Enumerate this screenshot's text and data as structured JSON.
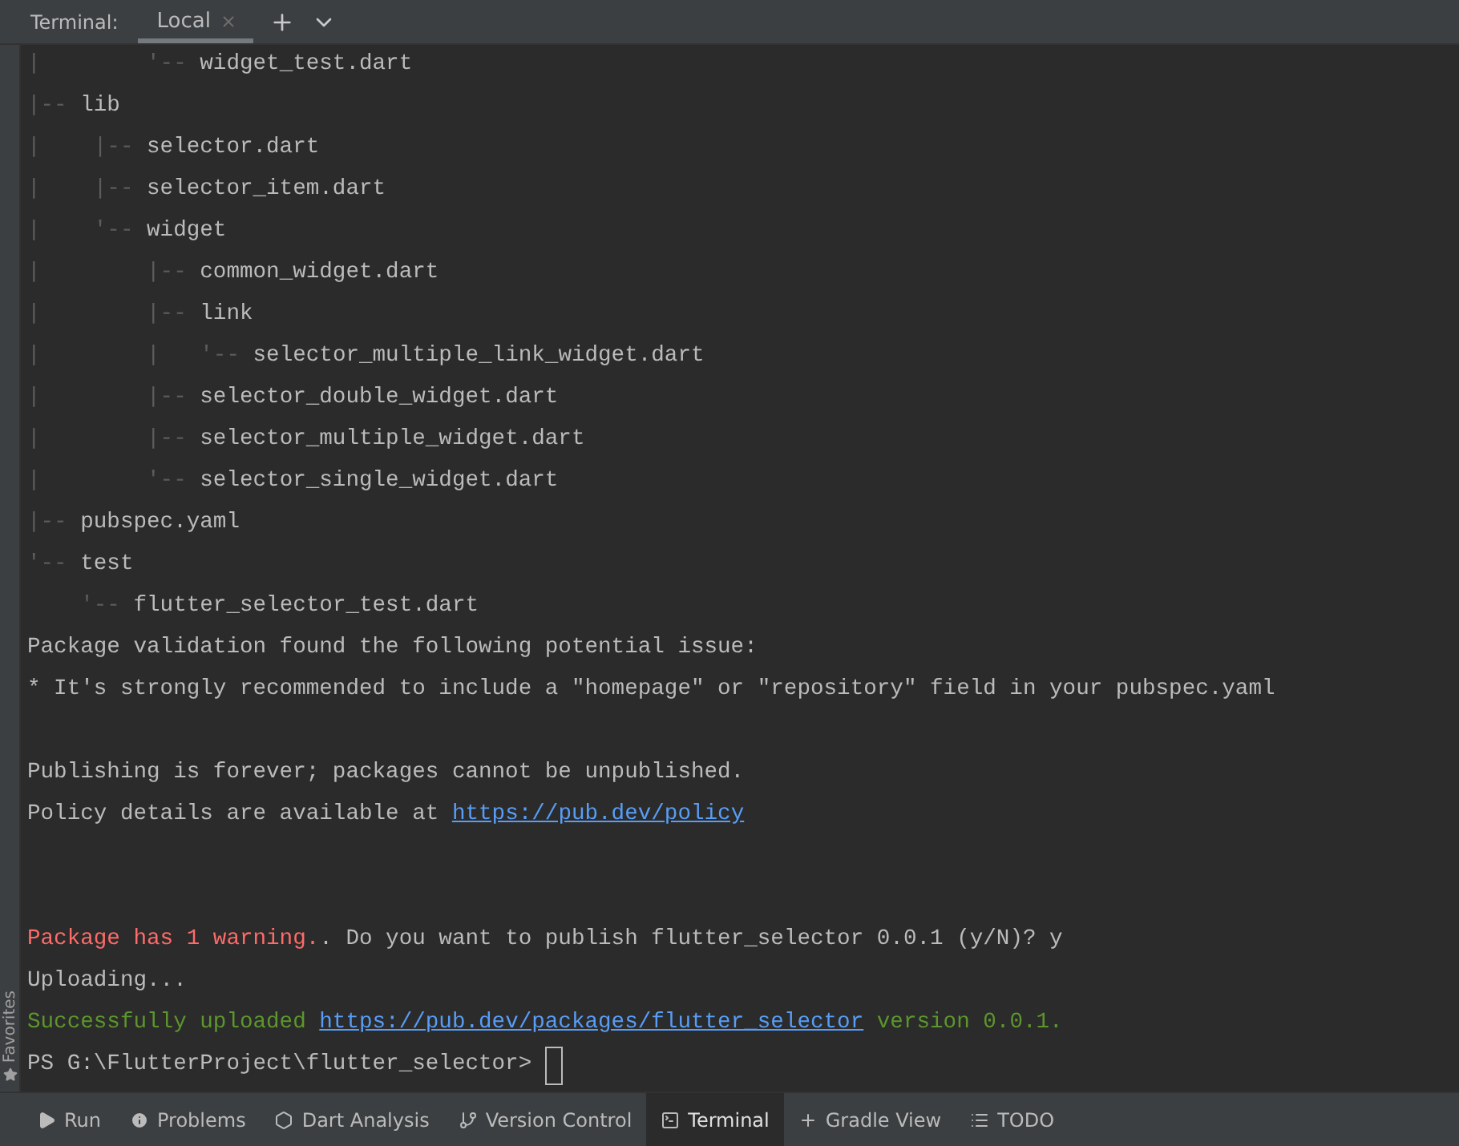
{
  "header": {
    "label": "Terminal:",
    "tabs": [
      {
        "label": "Local",
        "selected": true
      }
    ]
  },
  "side_strip": {
    "label": "Favorites"
  },
  "lines": [
    {
      "segments": [
        {
          "kind": "guide",
          "text": "|        '-- "
        },
        {
          "kind": "plain",
          "text": "widget_test.dart"
        }
      ]
    },
    {
      "segments": [
        {
          "kind": "guide",
          "text": "|-- "
        },
        {
          "kind": "plain",
          "text": "lib"
        }
      ]
    },
    {
      "segments": [
        {
          "kind": "guide",
          "text": "|    |-- "
        },
        {
          "kind": "plain",
          "text": "selector.dart"
        }
      ]
    },
    {
      "segments": [
        {
          "kind": "guide",
          "text": "|    |-- "
        },
        {
          "kind": "plain",
          "text": "selector_item.dart"
        }
      ]
    },
    {
      "segments": [
        {
          "kind": "guide",
          "text": "|    '-- "
        },
        {
          "kind": "plain",
          "text": "widget"
        }
      ]
    },
    {
      "segments": [
        {
          "kind": "guide",
          "text": "|        |-- "
        },
        {
          "kind": "plain",
          "text": "common_widget.dart"
        }
      ]
    },
    {
      "segments": [
        {
          "kind": "guide",
          "text": "|        |-- "
        },
        {
          "kind": "plain",
          "text": "link"
        }
      ]
    },
    {
      "segments": [
        {
          "kind": "guide",
          "text": "|        |   '-- "
        },
        {
          "kind": "plain",
          "text": "selector_multiple_link_widget.dart"
        }
      ]
    },
    {
      "segments": [
        {
          "kind": "guide",
          "text": "|        |-- "
        },
        {
          "kind": "plain",
          "text": "selector_double_widget.dart"
        }
      ]
    },
    {
      "segments": [
        {
          "kind": "guide",
          "text": "|        |-- "
        },
        {
          "kind": "plain",
          "text": "selector_multiple_widget.dart"
        }
      ]
    },
    {
      "segments": [
        {
          "kind": "guide",
          "text": "|        '-- "
        },
        {
          "kind": "plain",
          "text": "selector_single_widget.dart"
        }
      ]
    },
    {
      "segments": [
        {
          "kind": "guide",
          "text": "|-- "
        },
        {
          "kind": "plain",
          "text": "pubspec.yaml"
        }
      ]
    },
    {
      "segments": [
        {
          "kind": "guide",
          "text": "'-- "
        },
        {
          "kind": "plain",
          "text": "test"
        }
      ]
    },
    {
      "segments": [
        {
          "kind": "guide",
          "text": "    '-- "
        },
        {
          "kind": "plain",
          "text": "flutter_selector_test.dart"
        }
      ]
    },
    {
      "segments": [
        {
          "kind": "plain",
          "text": "Package validation found the following potential issue:"
        }
      ]
    },
    {
      "segments": [
        {
          "kind": "plain",
          "text": "* It's strongly recommended to include a \"homepage\" or \"repository\" field in your pubspec.yaml"
        }
      ]
    },
    {
      "kind": "blank"
    },
    {
      "segments": [
        {
          "kind": "plain",
          "text": "Publishing is forever; packages cannot be unpublished."
        }
      ]
    },
    {
      "segments": [
        {
          "kind": "plain",
          "text": "Policy details are available at "
        },
        {
          "kind": "link",
          "text": "https://pub.dev/policy"
        }
      ]
    },
    {
      "kind": "blank"
    },
    {
      "kind": "blank"
    },
    {
      "segments": [
        {
          "kind": "error",
          "text": "Package has 1 warning."
        },
        {
          "kind": "plain",
          "text": ". Do you want to publish flutter_selector 0.0.1 (y/N)? y"
        }
      ]
    },
    {
      "segments": [
        {
          "kind": "plain",
          "text": "Uploading..."
        }
      ]
    },
    {
      "segments": [
        {
          "kind": "success",
          "text": "Successfully uploaded "
        },
        {
          "kind": "link",
          "text": "https://pub.dev/packages/flutter_selector"
        },
        {
          "kind": "success",
          "text": " version 0.0.1."
        }
      ]
    },
    {
      "segments": [
        {
          "kind": "plain",
          "text": "PS G:\\FlutterProject\\flutter_selector> "
        },
        {
          "kind": "cursor"
        }
      ]
    }
  ],
  "tool_windows": [
    {
      "kind": "run",
      "label": "Run",
      "selected": false
    },
    {
      "kind": "problems",
      "label": "Problems",
      "selected": false
    },
    {
      "kind": "analysis",
      "label": "Dart Analysis",
      "selected": false
    },
    {
      "kind": "vcs",
      "label": "Version Control",
      "selected": false
    },
    {
      "kind": "terminal",
      "label": "Terminal",
      "selected": true
    },
    {
      "kind": "gradle",
      "label": "Gradle View",
      "selected": false
    },
    {
      "kind": "todo",
      "label": "TODO",
      "selected": false
    }
  ]
}
